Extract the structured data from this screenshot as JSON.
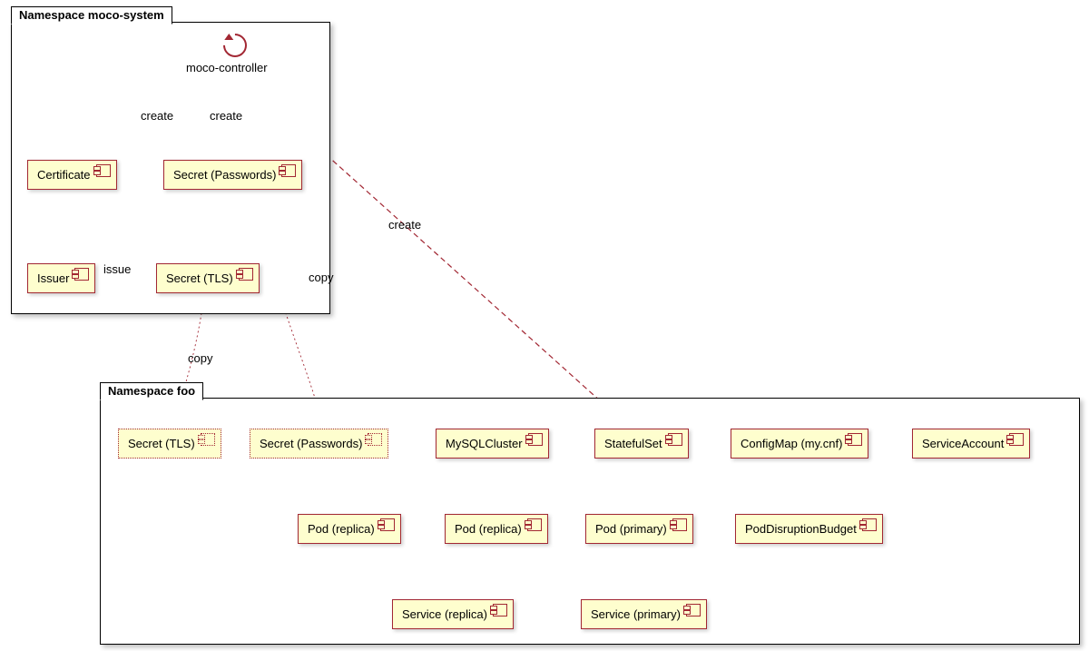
{
  "namespaces": {
    "system": {
      "title": "Namespace moco-system"
    },
    "foo": {
      "title": "Namespace foo"
    }
  },
  "controller": {
    "label": "moco-controller"
  },
  "components": {
    "certificate": "Certificate",
    "secret_passwords_sys": "Secret (Passwords)",
    "issuer": "Issuer",
    "secret_tls_sys": "Secret (TLS)",
    "secret_tls_foo": "Secret (TLS)",
    "secret_passwords_foo": "Secret (Passwords)",
    "mysqlcluster": "MySQLCluster",
    "statefulset": "StatefulSet",
    "configmap": "ConfigMap (my.cnf)",
    "serviceaccount": "ServiceAccount",
    "pod_replica_1": "Pod (replica)",
    "pod_replica_2": "Pod (replica)",
    "pod_primary": "Pod (primary)",
    "pdb": "PodDisruptionBudget",
    "svc_replica": "Service (replica)",
    "svc_primary": "Service (primary)"
  },
  "edge_labels": {
    "create1": "create",
    "create2": "create",
    "create3": "create",
    "issue": "issue",
    "copy1": "copy",
    "copy2": "copy"
  }
}
